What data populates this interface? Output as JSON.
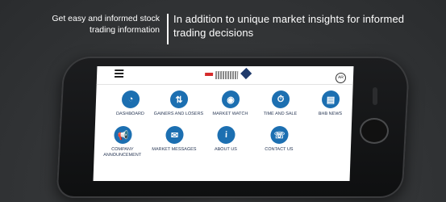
{
  "headline": {
    "left": "Get easy and informed stock trading information",
    "right": "In addition to unique market insights for informed trading decisions"
  },
  "app": {
    "lang_label": "AR",
    "tiles": [
      {
        "label": "DASHBOARD",
        "icon": "speedometer-icon",
        "glyph": "◔"
      },
      {
        "label": "GAINERS AND LOSERS",
        "icon": "gainers-losers-icon",
        "glyph": "⇅"
      },
      {
        "label": "MARKET WATCH",
        "icon": "market-watch-icon",
        "glyph": "◉"
      },
      {
        "label": "TIME AND SALE",
        "icon": "stopwatch-icon",
        "glyph": "⏱"
      },
      {
        "label": "BHB NEWS",
        "icon": "news-icon",
        "glyph": "▤"
      },
      {
        "label": "COMPANY ANNOUNCEMENT",
        "icon": "megaphone-icon",
        "glyph": "📢"
      },
      {
        "label": "MARKET MESSAGES",
        "icon": "messages-icon",
        "glyph": "✉"
      },
      {
        "label": "ABOUT US",
        "icon": "info-icon",
        "glyph": "i"
      },
      {
        "label": "CONTACT US",
        "icon": "phone-icon",
        "glyph": "☏"
      }
    ]
  },
  "colors": {
    "accent": "#1c6fb1",
    "label": "#1b2b4a"
  }
}
